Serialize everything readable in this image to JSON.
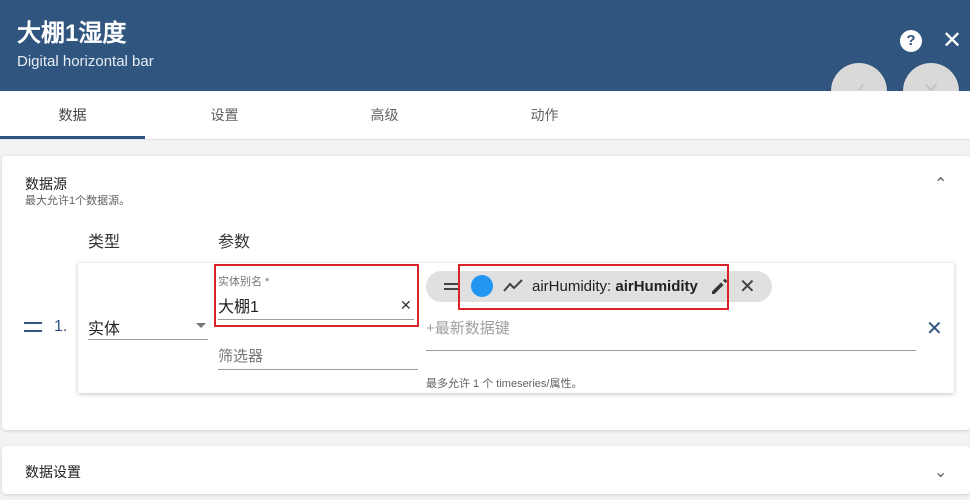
{
  "header": {
    "title": "大棚1湿度",
    "subtitle": "Digital horizontal bar",
    "help_icon": "?",
    "close_icon": "✕"
  },
  "fab": {
    "ok_icon": "✓",
    "cancel_icon": "✕"
  },
  "tabs": [
    {
      "label": "数据"
    },
    {
      "label": "设置"
    },
    {
      "label": "高级"
    },
    {
      "label": "动作"
    }
  ],
  "datasources": {
    "title": "数据源",
    "hint": "最大允许1个数据源。",
    "collapse_icon": "⌃",
    "columns": {
      "type": "类型",
      "params": "参数"
    },
    "row": {
      "index": "1.",
      "type_value": "实体",
      "alias_label": "实体别名 *",
      "alias_value": "大棚1",
      "alias_clear_icon": "✕",
      "filter_placeholder": "筛选器",
      "key_chip": {
        "color": "#2196f3",
        "label": "airHumidity:",
        "key": "airHumidity",
        "remove_icon": "✕"
      },
      "add_key_placeholder": "+最新数据键",
      "key_hint": "最多允许 1 个 timeseries/属性。",
      "remove_row_icon": "✕"
    }
  },
  "data_settings": {
    "title": "数据设置",
    "expand_icon": "⌄"
  },
  "colors": {
    "primary": "#305680",
    "highlight": "#d9222a",
    "chip_dot": "#2196f3"
  }
}
